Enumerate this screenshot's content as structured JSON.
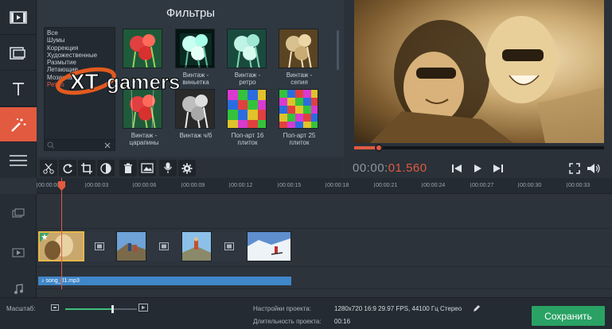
{
  "colors": {
    "accent": "#e25a3f",
    "save": "#2aa264",
    "audio_clip": "#3f87c9",
    "category_selected": "#e35c3f"
  },
  "left_toolbar": {
    "items": [
      {
        "name": "film-import-icon"
      },
      {
        "name": "clip-transition-icon"
      },
      {
        "name": "text-tool-icon"
      },
      {
        "name": "magic-wand-icon",
        "active": true
      },
      {
        "name": "menu-icon"
      }
    ]
  },
  "filters": {
    "title": "Фильтры",
    "categories": [
      "Все",
      "Шумы",
      "Коррекция",
      "Художественные",
      "Размытие",
      "Летающие",
      "Мозаика",
      "Ретро"
    ],
    "selected_category": "Ретро",
    "tiles": [
      {
        "label_1": "",
        "label_2": "",
        "style": "color"
      },
      {
        "label_1": "Винтаж -",
        "label_2": "виньетка",
        "style": "teal"
      },
      {
        "label_1": "Винтаж -",
        "label_2": "ретро",
        "style": "teal"
      },
      {
        "label_1": "Винтаж -",
        "label_2": "сепия",
        "style": "sepia"
      },
      {
        "label_1": "Винтаж -",
        "label_2": "царапины",
        "style": "color"
      },
      {
        "label_1": "Винтаж ч/б",
        "label_2": "",
        "style": "bw"
      },
      {
        "label_1": "Поп-арт 16",
        "label_2": "плиток",
        "style": "pop16"
      },
      {
        "label_1": "Поп-арт 25",
        "label_2": "плиток",
        "style": "pop25"
      }
    ]
  },
  "watermark": {
    "text_xt": "XT",
    "text_gamers": "gamers"
  },
  "player": {
    "progress": 0.1,
    "time_elapsed": "00:00:",
    "time_current": "01.560"
  },
  "edit_toolbar": {
    "tools": [
      "scissors-icon",
      "rotate-icon",
      "crop-icon",
      "color-adjust-icon",
      "trash-icon",
      "image-icon",
      "microphone-icon",
      "gear-icon"
    ]
  },
  "timeline": {
    "ticks": [
      "00:00:00",
      "00:00:03",
      "00:00:06",
      "00:00:09",
      "00:00:12",
      "00:00:15",
      "00:00:18",
      "00:00:21",
      "00:00:24",
      "00:00:27",
      "00:00:30",
      "00:00:33"
    ],
    "audio_clip_label": "♪ song_01.mp3",
    "video_clips": [
      "clip-couple",
      "clip-hikers",
      "clip-mountain-hiker",
      "clip-snow-skier"
    ]
  },
  "status": {
    "scale_label": "Масштаб:",
    "scale_value": 0.65,
    "settings_label": "Настройки проекта:",
    "settings_value": "1280x720 16:9 29.97 FPS, 44100 Гц Стерео",
    "duration_label": "Длительность проекта:",
    "duration_value": "00:16",
    "save_label": "Сохранить"
  }
}
